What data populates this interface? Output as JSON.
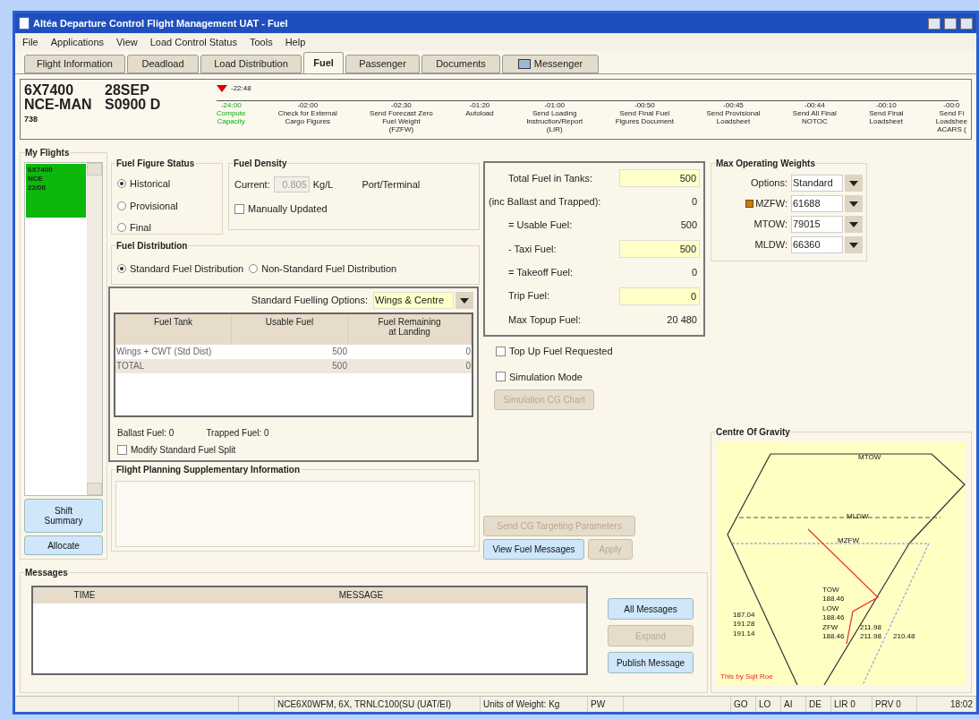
{
  "window": {
    "title": "Altéa Departure Control Flight Management UAT - Fuel"
  },
  "menu": [
    "File",
    "Applications",
    "View",
    "Load Control Status",
    "Tools",
    "Help"
  ],
  "tabs": [
    {
      "label": "Flight Information",
      "selected": false
    },
    {
      "label": "Deadload",
      "selected": false
    },
    {
      "label": "Load Distribution",
      "selected": false
    },
    {
      "label": "Fuel",
      "selected": true
    },
    {
      "label": "Passenger",
      "selected": false
    },
    {
      "label": "Documents",
      "selected": false
    },
    {
      "label": "Messenger",
      "selected": false
    }
  ],
  "flight_header": {
    "flight": "6X7400",
    "route": "NCE-MAN",
    "aircraft": "738",
    "date": "28SEP",
    "departure": "S0900 D",
    "current_time": "-22:48",
    "milestones": [
      {
        "time": "-24:00",
        "label": "Compute\nCapacity",
        "done": true
      },
      {
        "time": "-02:00",
        "label": "Check for External\nCargo Figures",
        "done": false
      },
      {
        "time": "-02:30",
        "label": "Send Forecast Zero\nFuel Weight\n(FZFW)",
        "done": false
      },
      {
        "time": "-01:20",
        "label": "Autoload",
        "done": false
      },
      {
        "time": "-01:00",
        "label": "Send Loading\nInstruction/Report\n(LIR)",
        "done": false
      },
      {
        "time": "-00:50",
        "label": "Send Final Fuel\nFigures Document",
        "done": false
      },
      {
        "time": "-00:45",
        "label": "Send Provisional\nLoadsheet",
        "done": false
      },
      {
        "time": "-00:44",
        "label": "Send All Final\nNOTOC",
        "done": false
      },
      {
        "time": "-00:10",
        "label": "Send Final\nLoadsheet",
        "done": false
      },
      {
        "time": "-00:0",
        "label": "Send Fi\nLoadshee\nACARS (",
        "done": false
      }
    ]
  },
  "my_flights": {
    "title": "My Flights",
    "flights": [
      {
        "lines": [
          "6X7400",
          "NCE",
          "22/08"
        ],
        "selected": true
      }
    ],
    "buttons": [
      {
        "label": "Shift\nSummary",
        "disabled": false
      },
      {
        "label": "Allocate",
        "disabled": false
      }
    ]
  },
  "fuel_figure_status": {
    "title": "Fuel Figure Status",
    "options": [
      {
        "label": "Historical",
        "selected": true
      },
      {
        "label": "Provisional",
        "selected": false
      },
      {
        "label": "Final",
        "selected": false
      }
    ]
  },
  "fuel_density": {
    "title": "Fuel Density",
    "current_label": "Current:",
    "current_value": "0.805",
    "unit": "Kg/L",
    "source": "Port/Terminal",
    "manually_updated": {
      "label": "Manually Updated",
      "checked": false
    }
  },
  "fuel_distribution": {
    "title": "Fuel Distribution",
    "options": [
      {
        "label": "Standard Fuel Distribution",
        "selected": true
      },
      {
        "label": "Non-Standard Fuel Distribution",
        "selected": false
      }
    ]
  },
  "fuelling": {
    "options_label": "Standard Fuelling Options:",
    "options_value": "Wings & Centre",
    "table": {
      "columns": [
        "Fuel Tank",
        "Usable Fuel",
        "Fuel Remaining\nat Landing"
      ],
      "rows": [
        [
          "Wings + CWT (Std Dist)",
          "500",
          "0"
        ],
        [
          "TOTAL",
          "500",
          "0"
        ]
      ]
    },
    "ballast": "Ballast Fuel: 0",
    "trapped": "Trapped Fuel: 0",
    "modify_split": {
      "label": "Modify Standard Fuel Split",
      "checked": false
    }
  },
  "supplementary": {
    "title": "Flight Planning Supplementary Information"
  },
  "fuel_totals": [
    {
      "label": "Total Fuel in Tanks:",
      "value": "500",
      "kind": "input"
    },
    {
      "label": "(inc Ballast and Trapped):",
      "value": "0",
      "kind": "value"
    },
    {
      "label": "= Usable Fuel:",
      "value": "500",
      "kind": "value"
    },
    {
      "label": "- Taxi Fuel:",
      "value": "500",
      "kind": "input"
    },
    {
      "label": "= Takeoff Fuel:",
      "value": "0",
      "kind": "value"
    },
    {
      "label": "Trip Fuel:",
      "value": "0",
      "kind": "input"
    },
    {
      "label": "Max Topup Fuel:",
      "value": "20 480",
      "kind": "value"
    }
  ],
  "checkboxes": [
    {
      "label": "Top Up Fuel Requested",
      "checked": false
    },
    {
      "label": "Simulation Mode",
      "checked": false
    }
  ],
  "simulation_button": {
    "label": "Simulation CG Chart",
    "disabled": true
  },
  "action_buttons": [
    {
      "label": "Send CG Targeting Parameters",
      "disabled": true
    },
    {
      "label": "View Fuel Messages",
      "disabled": false
    },
    {
      "label": "Apply",
      "disabled": true
    }
  ],
  "max_operating_weights": {
    "title": "Max Operating Weights",
    "rows": [
      {
        "label": "Options:",
        "value": "Standard",
        "warning": false
      },
      {
        "label": "MZFW:",
        "value": "61688",
        "warning": true
      },
      {
        "label": "MTOW:",
        "value": "79015",
        "warning": false
      },
      {
        "label": "MLDW:",
        "value": "66360",
        "warning": false
      }
    ]
  },
  "centre_of_gravity": {
    "title": "Centre Of Gravity",
    "labels": [
      "MTOW",
      "MLDW",
      "MZFW",
      "TOW",
      "188.46",
      "LOW",
      "188.46",
      "ZFW",
      "188.46",
      "187.04",
      "191.28",
      "191.14",
      "211.98",
      "211.98",
      "210.48"
    ],
    "note": "This by Sqlt Roe"
  },
  "messages": {
    "title": "Messages",
    "columns": [
      "TIME",
      "MESSAGE"
    ],
    "buttons": [
      {
        "label": "All Messages",
        "disabled": false
      },
      {
        "label": "Expand",
        "disabled": true
      },
      {
        "label": "Publish Message",
        "disabled": false
      }
    ]
  },
  "status_bar": [
    "NCE6X0WFM, 6X, TRNLC100(SU (UAT/EI)",
    "Units of Weight: Kg",
    "PW",
    "GO",
    "LO",
    "AI",
    "DE",
    "LIR 0",
    "PRV 0",
    "18:02"
  ]
}
